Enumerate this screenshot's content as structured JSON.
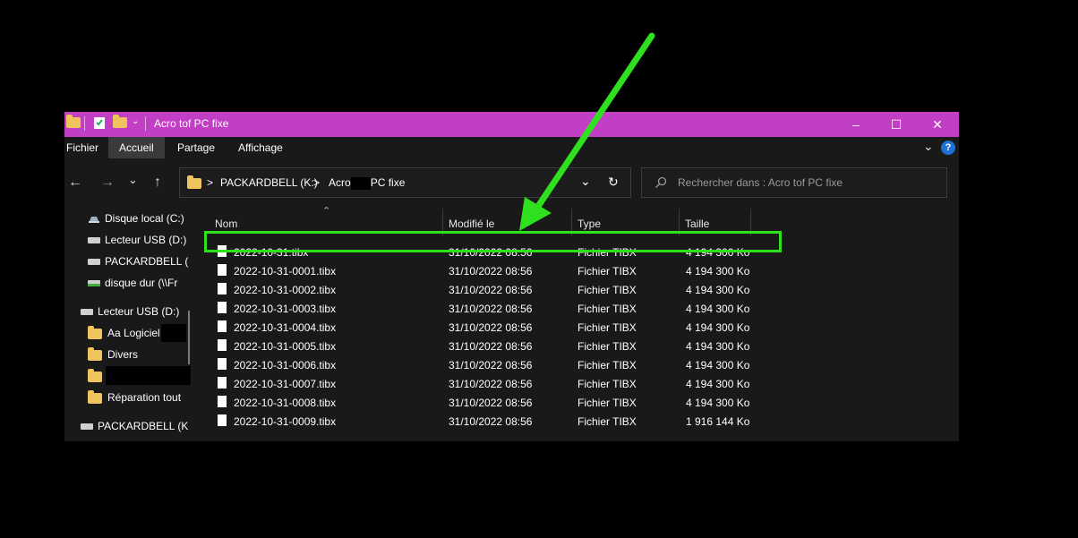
{
  "window": {
    "title": "Acro tof PC fixe",
    "controls": {
      "minimize": "–",
      "maximize": "☐",
      "close": "✕"
    },
    "titlebar_color": "#c13ec5"
  },
  "ribbon": {
    "tabs": [
      "Fichier",
      "Accueil",
      "Partage",
      "Affichage"
    ],
    "active_tab": "Accueil",
    "help_glyph": "?"
  },
  "address": {
    "crumbs": [
      "PACKARDBELL (K:)",
      "Acro",
      "PC fixe"
    ],
    "sep": ">",
    "dropdown_glyph": "⌄",
    "refresh_glyph": "↻"
  },
  "search": {
    "placeholder": "Rechercher dans : Acro tof PC fixe",
    "icon": "search-icon"
  },
  "sidebar": {
    "items": [
      {
        "label": "Disque local (C:)",
        "icon": "drive-icon"
      },
      {
        "label": "Lecteur USB (D:)",
        "icon": "usb-drive-icon"
      },
      {
        "label": "PACKARDBELL (",
        "icon": "usb-drive-icon"
      },
      {
        "label": "disque dur (\\\\Fr",
        "icon": "network-drive-icon"
      },
      {
        "label": "Lecteur USB (D:)",
        "icon": "usb-drive-icon"
      },
      {
        "label": "Aa Logiciel",
        "icon": "folder-icon"
      },
      {
        "label": "Divers",
        "icon": "folder-icon"
      },
      {
        "label": "",
        "icon": "folder-icon"
      },
      {
        "label": "Réparation tout",
        "icon": "folder-icon"
      },
      {
        "label": "PACKARDBELL (K",
        "icon": "usb-drive-icon"
      }
    ]
  },
  "table": {
    "columns": [
      "Nom",
      "Modifié le",
      "Type",
      "Taille"
    ],
    "rows": [
      [
        "2022-10-31.tibx",
        "31/10/2022 08:56",
        "Fichier TIBX",
        "4 194 300 Ko"
      ],
      [
        "2022-10-31-0001.tibx",
        "31/10/2022 08:56",
        "Fichier TIBX",
        "4 194 300 Ko"
      ],
      [
        "2022-10-31-0002.tibx",
        "31/10/2022 08:56",
        "Fichier TIBX",
        "4 194 300 Ko"
      ],
      [
        "2022-10-31-0003.tibx",
        "31/10/2022 08:56",
        "Fichier TIBX",
        "4 194 300 Ko"
      ],
      [
        "2022-10-31-0004.tibx",
        "31/10/2022 08:56",
        "Fichier TIBX",
        "4 194 300 Ko"
      ],
      [
        "2022-10-31-0005.tibx",
        "31/10/2022 08:56",
        "Fichier TIBX",
        "4 194 300 Ko"
      ],
      [
        "2022-10-31-0006.tibx",
        "31/10/2022 08:56",
        "Fichier TIBX",
        "4 194 300 Ko"
      ],
      [
        "2022-10-31-0007.tibx",
        "31/10/2022 08:56",
        "Fichier TIBX",
        "4 194 300 Ko"
      ],
      [
        "2022-10-31-0008.tibx",
        "31/10/2022 08:56",
        "Fichier TIBX",
        "4 194 300 Ko"
      ],
      [
        "2022-10-31-0009.tibx",
        "31/10/2022 08:56",
        "Fichier TIBX",
        "1 916 144 Ko"
      ]
    ],
    "highlighted_row": 0,
    "highlight_color": "#2fe01f"
  },
  "annotation": {
    "arrow_color": "#2fe01f"
  }
}
